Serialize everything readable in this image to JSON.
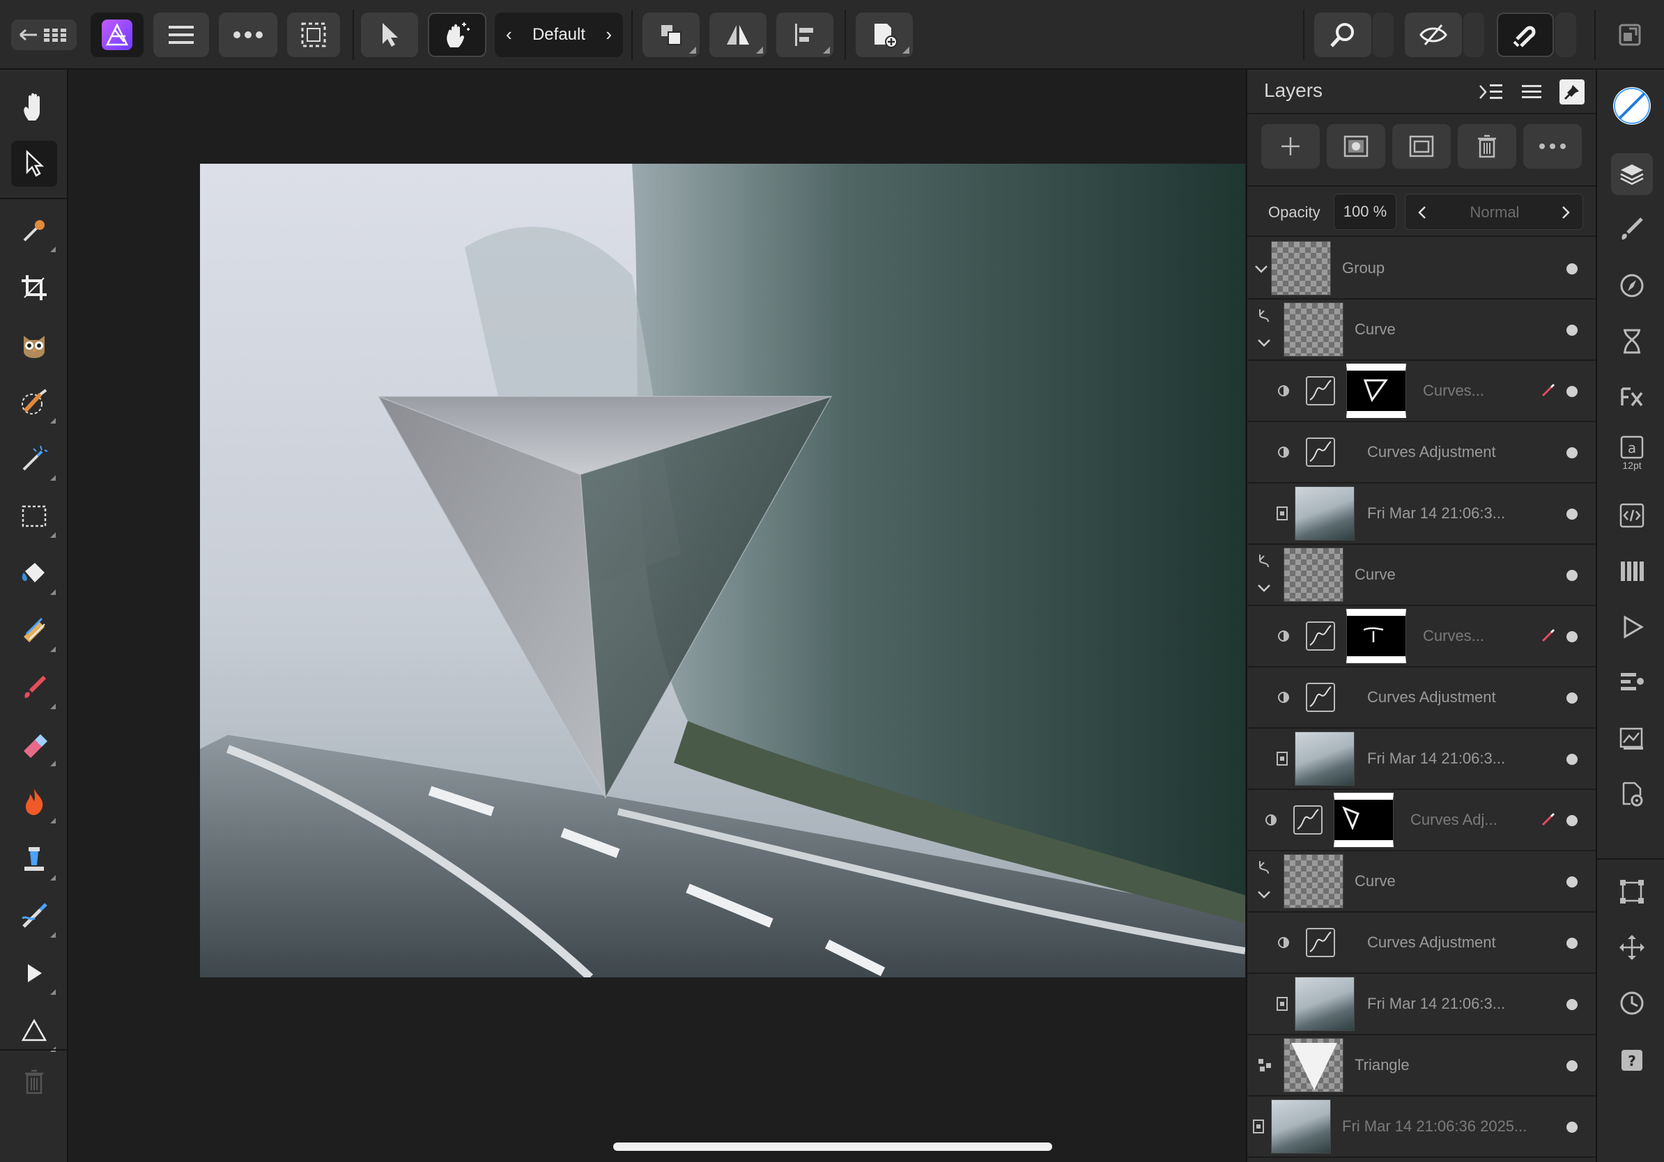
{
  "toolbar": {
    "persona_label": "Default"
  },
  "layers_panel": {
    "title": "Layers",
    "opacity_label": "Opacity",
    "opacity_value": "100 %",
    "blend_mode": "Normal",
    "rows": [
      {
        "label": "Group"
      },
      {
        "label": "Curve"
      },
      {
        "label": "Curves..."
      },
      {
        "label": "Curves Adjustment"
      },
      {
        "label": "Fri Mar 14 21:06:3..."
      },
      {
        "label": "Curve"
      },
      {
        "label": "Curves..."
      },
      {
        "label": "Curves Adjustment"
      },
      {
        "label": "Fri Mar 14 21:06:3..."
      },
      {
        "label": "Curves Adj..."
      },
      {
        "label": "Curve"
      },
      {
        "label": "Curves Adjustment"
      },
      {
        "label": "Fri Mar 14 21:06:3..."
      },
      {
        "label": "Triangle"
      },
      {
        "label": "Fri Mar 14 21:06:36 2025..."
      }
    ]
  },
  "studio": {
    "text_size_label": "12pt"
  },
  "colors": {
    "accent_purple": "#8e44ff",
    "brush_red": "#e74c5c",
    "canvas_bg": "#1e1e1e",
    "panel_bg": "#2a2a2a"
  },
  "icons": {
    "left_tools": [
      "hand-icon",
      "move-icon",
      "color-picker-icon",
      "crop-icon",
      "owl-icon",
      "selection-brush-icon",
      "magic-wand-icon",
      "marquee-icon",
      "flood-fill-icon",
      "inpainting-icon",
      "paint-brush-icon",
      "eraser-icon",
      "burn-icon",
      "clone-icon",
      "smudge-icon",
      "node-icon",
      "triangle-shape-icon",
      "trash-icon"
    ],
    "studio": [
      "color-icon",
      "layers-icon",
      "brushes-icon",
      "navigator-icon",
      "history-icon",
      "fx-icon",
      "text-icon",
      "code-icon",
      "swatches-icon",
      "play-icon",
      "adjustments-icon",
      "stock-icon",
      "settings-icon",
      "transform-icon",
      "move-cross-icon",
      "clock-icon",
      "help-icon"
    ]
  }
}
